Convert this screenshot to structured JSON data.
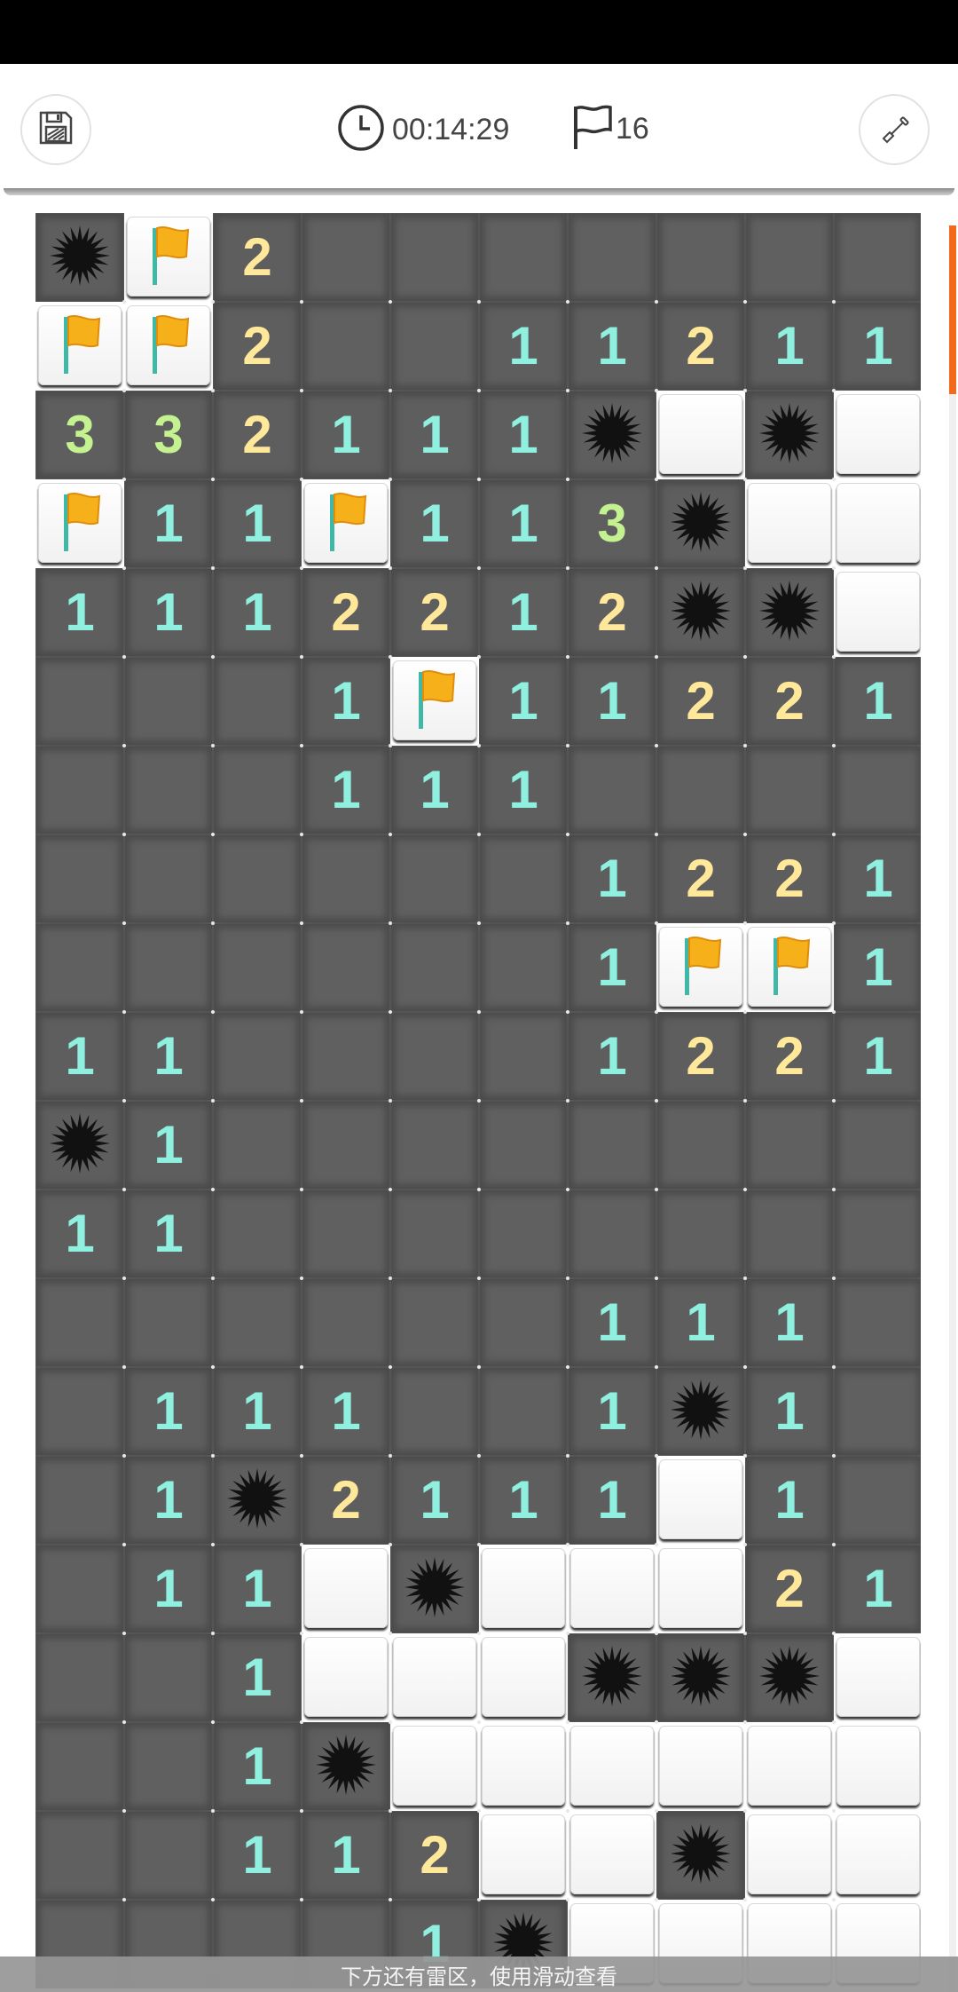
{
  "header": {
    "timer": "00:14:29",
    "flags_count": "16",
    "icons": {
      "save": "save-disk-icon",
      "clock": "clock-icon",
      "flag": "flag-outline-icon",
      "tool": "shovel-icon"
    }
  },
  "board": {
    "cols": 10,
    "rows": 20,
    "legend": "U=unopened, E=opened empty, W=revealed white, F=flag, M=mine, digit=adjacent count",
    "grid": [
      [
        "M",
        "F",
        "2",
        "U",
        "U",
        "U",
        "U",
        "U",
        "U",
        "U"
      ],
      [
        "F",
        "F",
        "2",
        "U",
        "U",
        "1",
        "1",
        "2",
        "1",
        "1"
      ],
      [
        "3",
        "3",
        "2",
        "1",
        "1",
        "1",
        "M",
        "W",
        "M",
        "W"
      ],
      [
        "F",
        "1",
        "1",
        "F",
        "1",
        "1",
        "3",
        "M",
        "W",
        "W"
      ],
      [
        "1",
        "1",
        "1",
        "2",
        "2",
        "1",
        "2",
        "M",
        "M",
        "W"
      ],
      [
        "U",
        "U",
        "U",
        "1",
        "F",
        "1",
        "1",
        "2",
        "2",
        "1"
      ],
      [
        "U",
        "U",
        "U",
        "1",
        "1",
        "1",
        "U",
        "U",
        "U",
        "U"
      ],
      [
        "U",
        "U",
        "U",
        "U",
        "U",
        "U",
        "1",
        "2",
        "2",
        "1"
      ],
      [
        "U",
        "U",
        "U",
        "U",
        "U",
        "U",
        "1",
        "F",
        "F",
        "1"
      ],
      [
        "1",
        "1",
        "U",
        "U",
        "U",
        "U",
        "1",
        "2",
        "2",
        "1"
      ],
      [
        "M",
        "1",
        "U",
        "U",
        "U",
        "U",
        "U",
        "U",
        "U",
        "U"
      ],
      [
        "1",
        "1",
        "U",
        "U",
        "U",
        "U",
        "U",
        "U",
        "U",
        "U"
      ],
      [
        "U",
        "U",
        "U",
        "U",
        "U",
        "U",
        "1",
        "1",
        "1",
        "U"
      ],
      [
        "U",
        "1",
        "1",
        "1",
        "U",
        "U",
        "1",
        "M",
        "1",
        "U"
      ],
      [
        "U",
        "1",
        "M",
        "2",
        "1",
        "1",
        "1",
        "W",
        "1",
        "U"
      ],
      [
        "U",
        "1",
        "1",
        "W",
        "M",
        "W",
        "W",
        "W",
        "2",
        "1"
      ],
      [
        "U",
        "U",
        "1",
        "W",
        "W",
        "W",
        "M",
        "M",
        "M",
        "W"
      ],
      [
        "U",
        "U",
        "1",
        "M",
        "W",
        "W",
        "W",
        "W",
        "W",
        "W"
      ],
      [
        "U",
        "U",
        "1",
        "1",
        "2",
        "W",
        "W",
        "M",
        "W",
        "W"
      ],
      [
        "U",
        "U",
        "U",
        "U",
        "1",
        "M",
        "W",
        "W",
        "W",
        "W"
      ]
    ]
  },
  "bottom_hint": "下方还有雷区，使用滑动查看",
  "colors": {
    "n1": "#8ff0e0",
    "n2": "#ffe89a",
    "n3": "#c4f291",
    "accent": "#f26a1b"
  }
}
